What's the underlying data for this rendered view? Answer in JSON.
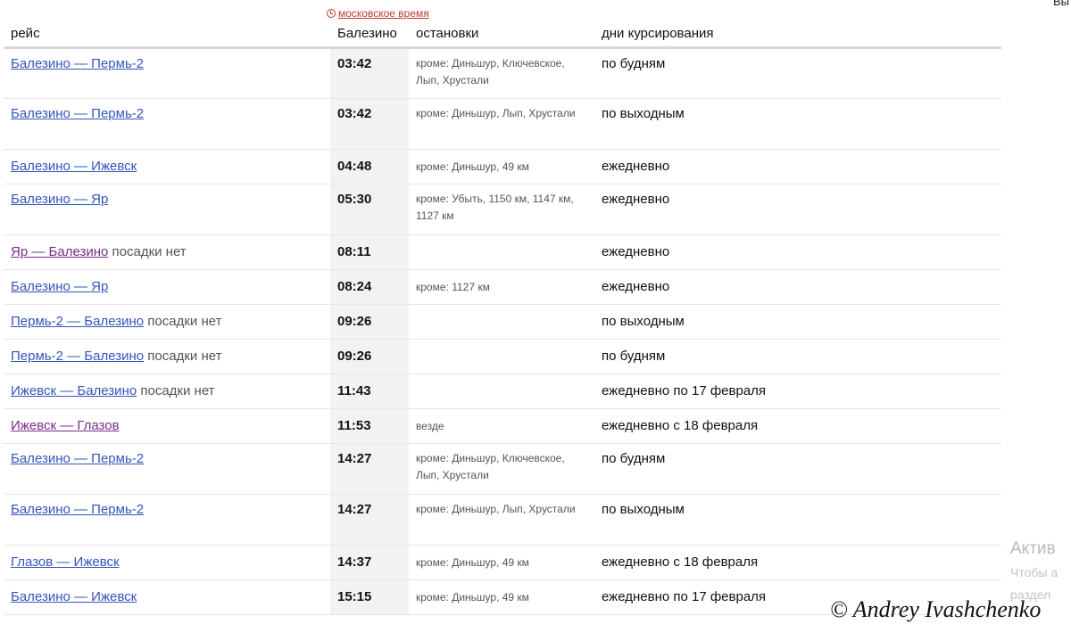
{
  "corner_text": "Вы",
  "moscow_time": "московское время",
  "headers": {
    "route": "рейс",
    "time": "Балезино",
    "stops": "остановки",
    "days": "дни курсирования"
  },
  "rows": [
    {
      "route": "Балезино — Пермь-2",
      "note": "",
      "time": "03:42",
      "stops": "кроме: Диньшур, Ключевское, Лып, Хрустали",
      "days": "по будням"
    },
    {
      "route": "Балезино — Пермь-2",
      "note": "",
      "time": "03:42",
      "stops": "кроме: Диньшур, Лып, Хрустали",
      "days": "по выходным"
    },
    {
      "route": "Балезино — Ижевск",
      "note": "",
      "time": "04:48",
      "stops": "кроме: Диньшур, 49 км",
      "days": "ежедневно"
    },
    {
      "route": "Балезино — Яр",
      "note": "",
      "time": "05:30",
      "stops": "кроме: Убыть, 1150 км, 1147 км, 1127 км",
      "days": "ежедневно"
    },
    {
      "route": "Яр — Балезино",
      "note": "посадки нет",
      "time": "08:11",
      "stops": "",
      "days": "ежедневно"
    },
    {
      "route": "Балезино — Яр",
      "note": "",
      "time": "08:24",
      "stops": "кроме: 1127 км",
      "days": "ежедневно"
    },
    {
      "route": "Пермь-2 — Балезино",
      "note": "посадки нет",
      "time": "09:26",
      "stops": "",
      "days": "по выходным"
    },
    {
      "route": "Пермь-2 — Балезино",
      "note": "посадки нет",
      "time": "09:26",
      "stops": "",
      "days": "по будням"
    },
    {
      "route": "Ижевск — Балезино",
      "note": "посадки нет",
      "time": "11:43",
      "stops": "",
      "days": "ежедневно по 17 февраля"
    },
    {
      "route": "Ижевск — Глазов",
      "note": "",
      "time": "11:53",
      "stops": "везде",
      "days": "ежедневно с 18 февраля"
    },
    {
      "route": "Балезино — Пермь-2",
      "note": "",
      "time": "14:27",
      "stops": "кроме: Диньшур, Ключевское, Лып, Хрустали",
      "days": "по будням"
    },
    {
      "route": "Балезино — Пермь-2",
      "note": "",
      "time": "14:27",
      "stops": "кроме: Диньшур, Лып, Хрустали",
      "days": "по выходным"
    },
    {
      "route": "Глазов — Ижевск",
      "note": "",
      "time": "14:37",
      "stops": "кроме: Диньшур, 49 км",
      "days": "ежедневно с 18 февраля"
    },
    {
      "route": "Балезино — Ижевск",
      "note": "",
      "time": "15:15",
      "stops": "кроме: Диньшур, 49 км",
      "days": "ежедневно по 17 февраля"
    }
  ],
  "activation": {
    "title": "Актив",
    "line1": "Чтобы а",
    "line2": "раздел"
  },
  "copyright": "© Andrey Ivashchenko"
}
